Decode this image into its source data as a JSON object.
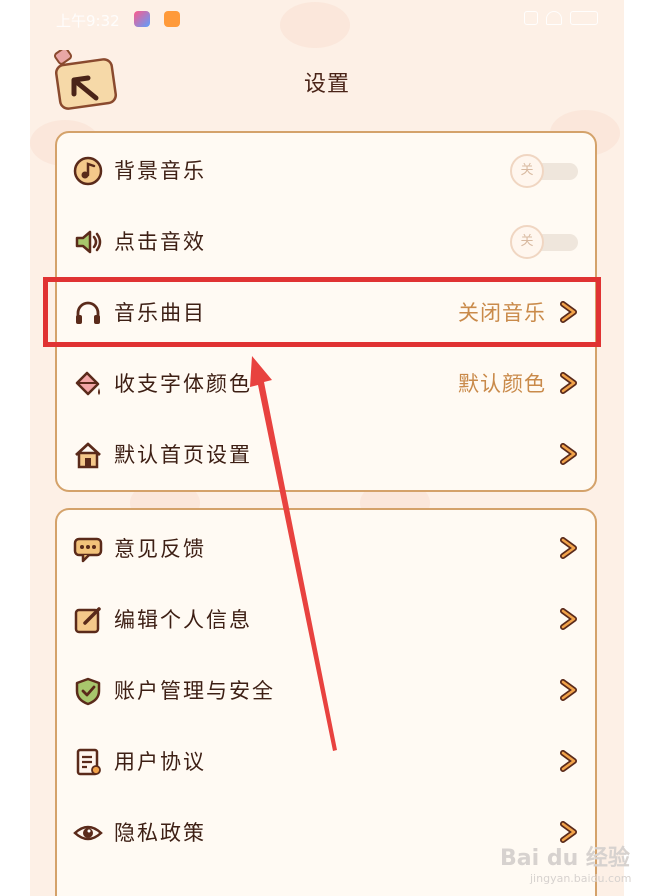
{
  "status_bar": {
    "time": "上午9:32"
  },
  "header": {
    "title": "设置"
  },
  "group1": [
    {
      "name": "row-background-music",
      "icon": "music-note-icon",
      "label": "背景音乐",
      "type": "toggle",
      "toggle_text": "关",
      "on": false
    },
    {
      "name": "row-click-sound",
      "icon": "speaker-icon",
      "label": "点击音效",
      "type": "toggle",
      "toggle_text": "关",
      "on": false
    },
    {
      "name": "row-music-track",
      "icon": "headphones-icon",
      "label": "音乐曲目",
      "type": "link",
      "value": "关闭音乐"
    },
    {
      "name": "row-font-color",
      "icon": "paint-bucket-icon",
      "label": "收支字体颜色",
      "type": "link",
      "value": "默认颜色"
    },
    {
      "name": "row-default-home",
      "icon": "house-icon",
      "label": "默认首页设置",
      "type": "link",
      "value": ""
    }
  ],
  "group2": [
    {
      "name": "row-feedback",
      "icon": "chat-bubble-icon",
      "label": "意见反馈",
      "type": "link",
      "value": ""
    },
    {
      "name": "row-edit-profile",
      "icon": "edit-icon",
      "label": "编辑个人信息",
      "type": "link",
      "value": ""
    },
    {
      "name": "row-account-security",
      "icon": "shield-icon",
      "label": "账户管理与安全",
      "type": "link",
      "value": ""
    },
    {
      "name": "row-user-agreement",
      "icon": "document-icon",
      "label": "用户协议",
      "type": "link",
      "value": ""
    },
    {
      "name": "row-privacy-policy",
      "icon": "eye-icon",
      "label": "隐私政策",
      "type": "link",
      "value": ""
    }
  ],
  "watermark": {
    "text": "Bai du 经验",
    "sub": "jingyan.baidu.com"
  },
  "colors": {
    "accent": "#c98a4a",
    "text": "#3d1f14",
    "border": "#d4a26a",
    "highlight": "#e03232",
    "arrow": "#e8423f"
  }
}
